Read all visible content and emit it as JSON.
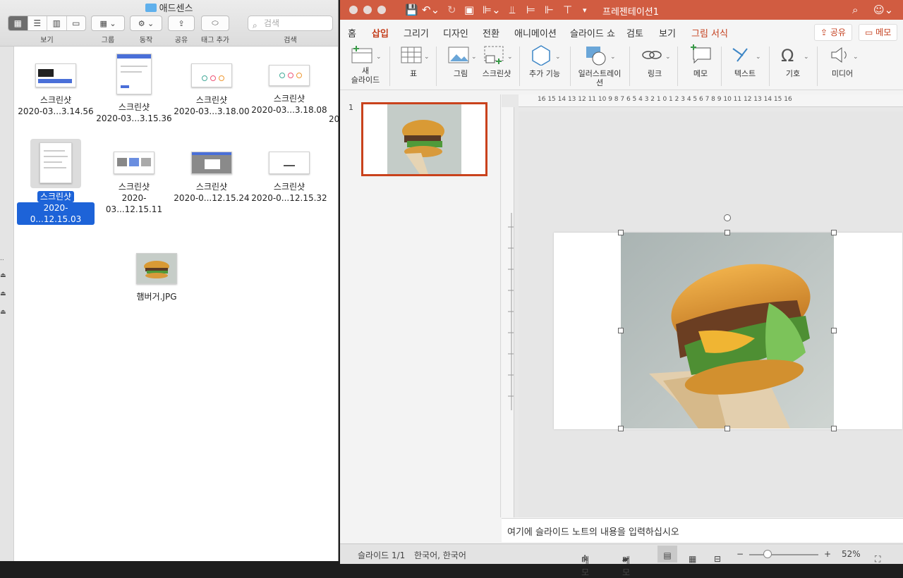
{
  "finder": {
    "title": "애드센스",
    "toolbar": {
      "view_label": "보기",
      "group_label": "그룹",
      "action_label": "동작",
      "share_label": "공유",
      "tag_label": "태그 추가",
      "search_label": "검색",
      "search_placeholder": "검색"
    },
    "files": [
      {
        "n1": "스크린샷",
        "n2": "2020-03...3.14.56"
      },
      {
        "n1": "스크린샷",
        "n2": "2020-03...3.15.36"
      },
      {
        "n1": "스크린샷",
        "n2": "2020-03...3.18.00"
      },
      {
        "n1": "스크린샷",
        "n2": "2020-03...3.18.08"
      },
      {
        "n1": "스크린샷",
        "n2": "2020-0...12.15.03"
      },
      {
        "n1": "스크린샷",
        "n2": "2020-03...12.15.11"
      },
      {
        "n1": "스크린샷",
        "n2": "2020-0...12.15.24"
      },
      {
        "n1": "스크린샷",
        "n2": "2020-0...12.15.32"
      },
      {
        "n1": "햄버거.JPG",
        "n2": ""
      }
    ],
    "overflow_text": "20"
  },
  "ppt": {
    "doc_title": "프레젠테이션1",
    "tabs": [
      "홈",
      "삽입",
      "그리기",
      "디자인",
      "전환",
      "애니메이션",
      "슬라이드 쇼",
      "검토",
      "보기",
      "그림 서식"
    ],
    "share_label": "공유",
    "memo_label": "메모",
    "ribbon": {
      "new_slide": "새\n슬라이드",
      "table": "표",
      "picture": "그림",
      "screenshot": "스크린샷",
      "addins": "추가 기능",
      "illustration": "일러스트레이션",
      "link": "링크",
      "comment": "메모",
      "text": "텍스트",
      "symbol": "기호",
      "media": "미디어"
    },
    "slide_number": "1",
    "ruler_text": "16 15 14 13 12 11 10 9 8 7 6 5 4 3 2 1 0 1 2 3 4 5 6 7 8 9 10 11 12 13 14 15 16",
    "notes_placeholder": "여기에 슬라이드 노트의 내용을 입력하십시오",
    "status": {
      "slide_info": "슬라이드 1/1",
      "language": "한국어, 한국어",
      "notes_btn": "메모",
      "comments_btn": "메모",
      "zoom": "52%"
    }
  }
}
